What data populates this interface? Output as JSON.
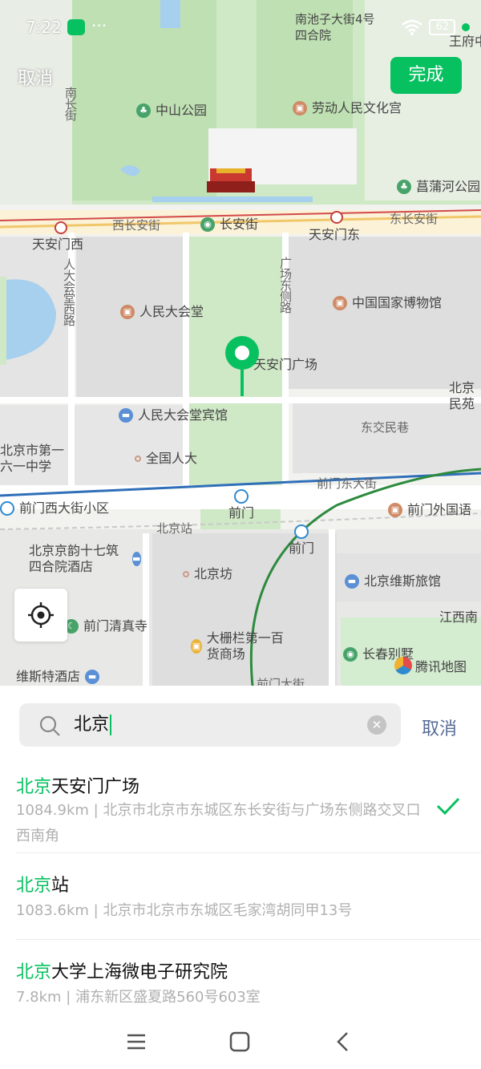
{
  "status_bar": {
    "time": "7:22",
    "more": "···",
    "battery": "62"
  },
  "top_bar": {
    "cancel_label": "取消",
    "done_label": "完成"
  },
  "map": {
    "pois": {
      "zhongshan_park": "中山公园",
      "laodong_palace": "劳动人民文化宫",
      "changpu_park": "菖蒲河公园",
      "great_hall": "人民大会堂",
      "national_museum": "中国国家博物馆",
      "tiananmen_square": "天安门广场",
      "great_hall_hotel": "人民大会堂宾馆",
      "npc": "全国人大",
      "beijing_161": "北京市第一六一中学",
      "qianmen_west_community": "前门西大街小区",
      "qianmen_foreign": "前门外国语",
      "beijing_station_label": "北京站",
      "jingyun_hotel": "北京京韵十七筑四合院酒店",
      "beijingfang": "北京坊",
      "weiming_hostel": "北京维斯旅馆",
      "qianmen_mosque": "前门清真寺",
      "dashilan_store": "大栅栏第一百货商场",
      "changchun_villa": "长春别墅",
      "visite_hotel": "维斯特酒店",
      "jiangxi": "江西南",
      "beijing_minsu": "北京民苑",
      "wangfu": "王府中",
      "nanchizi": "南池子大街4号四合院"
    },
    "roads": {
      "west_changan": "西长安街",
      "changan": "长安街",
      "east_changan": "东长安街",
      "tiananmen_west": "天安门西",
      "tiananmen_east": "天安门东",
      "nanchang": "南长街",
      "renda_west": "人大会堂西路",
      "square_east": "广场东侧路",
      "dongjiao": "东交民巷",
      "qianmen_east": "前门东大街",
      "qianmen": "前门",
      "qianmen2": "前门",
      "qianmen_street": "前门大街"
    },
    "logo": "腾讯地图"
  },
  "search": {
    "query": "北京",
    "cancel_label": "取消"
  },
  "results": [
    {
      "highlight": "北京",
      "rest": "天安门广场",
      "desc": "1084.9km | 北京市北京市东城区东长安街与广场东侧路交叉口西南角",
      "selected": true
    },
    {
      "highlight": "北京",
      "rest": "站",
      "desc": "1083.6km | 北京市北京市东城区毛家湾胡同甲13号",
      "selected": false
    },
    {
      "highlight": "北京",
      "rest": "大学上海微电子研究院",
      "desc": "7.8km | 浦东新区盛夏路560号603室",
      "selected": false
    }
  ],
  "colors": {
    "accent": "#07c160",
    "link": "#576b95"
  },
  "icons": [
    "wechat-icon",
    "wifi-icon",
    "battery-icon",
    "search-icon",
    "clear-icon",
    "check-icon",
    "locate-icon",
    "marker-icon",
    "menu-icon",
    "home-icon",
    "back-icon"
  ]
}
